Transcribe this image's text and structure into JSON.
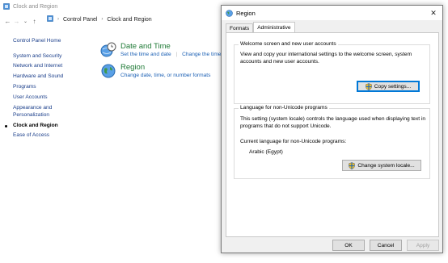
{
  "control_panel": {
    "window_title": "Clock and Region",
    "breadcrumb": [
      "Control Panel",
      "Clock and Region"
    ],
    "sidebar": [
      "Control Panel Home",
      "System and Security",
      "Network and Internet",
      "Hardware and Sound",
      "Programs",
      "User Accounts",
      "Appearance and Personalization",
      "Clock and Region",
      "Ease of Access"
    ],
    "categories": {
      "datetime": {
        "title": "Date and Time",
        "link1": "Set the time and date",
        "link2": "Change the time"
      },
      "region": {
        "title": "Region",
        "link1": "Change date, time, or number formats"
      }
    }
  },
  "dialog": {
    "title": "Region",
    "tabs": [
      "Formats",
      "Administrative"
    ],
    "welcome": {
      "legend": "Welcome screen and new user accounts",
      "description": "View and copy your international settings to the welcome screen, system accounts and new user accounts.",
      "button": "Copy settings..."
    },
    "nonunicode": {
      "legend": "Language for non-Unicode programs",
      "description": "This setting (system locale) controls the language used when displaying text in programs that do not support Unicode.",
      "current_label": "Current language for non-Unicode programs:",
      "current_value": "Arabic (Egypt)",
      "button": "Change system locale..."
    },
    "footer": {
      "ok": "OK",
      "cancel": "Cancel",
      "apply": "Apply"
    }
  },
  "colors": {
    "link": "#1a5fb4",
    "category": "#1f7a36",
    "focus": "#0078d7"
  },
  "icons": [
    "control-panel-icon",
    "back-arrow-icon",
    "forward-arrow-icon",
    "dropdown-icon",
    "up-arrow-icon",
    "clock-globe-icon",
    "region-globe-icon",
    "shield-icon",
    "close-icon"
  ]
}
